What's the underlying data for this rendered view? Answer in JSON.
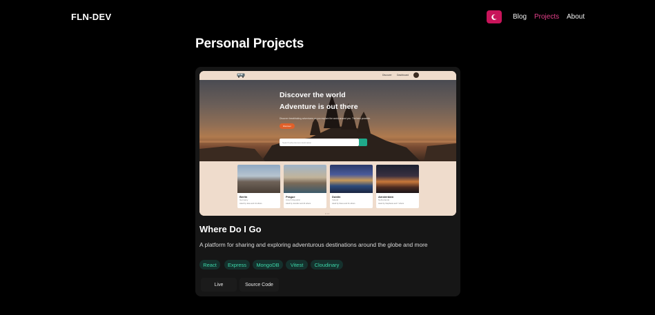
{
  "header": {
    "brand": "FLN-DEV",
    "theme_icon": "moon-icon",
    "accent": "#c8145a",
    "nav": [
      {
        "label": "Blog",
        "active": false
      },
      {
        "label": "Projects",
        "active": true
      },
      {
        "label": "About",
        "active": false
      }
    ]
  },
  "page": {
    "title": "Personal Projects"
  },
  "project": {
    "preview": {
      "nav_links": [
        "Discover",
        "Dashboard"
      ],
      "hero_line1": "Discover the world",
      "hero_line2": "Adventure is out there",
      "hero_sub": "Discover breathtaking adventures as you explore the world around you. The best possible.",
      "hero_button": "Discover",
      "search_placeholder": "Search adventurous destination",
      "cities": [
        {
          "name": "Berlin",
          "country": "Germany",
          "meta": "Liked by Jane and 13 others"
        },
        {
          "name": "Prague",
          "country": "Czech Republic",
          "meta": "Liked by Jennifer and 24 others"
        },
        {
          "name": "Dublin",
          "country": "Ireland",
          "meta": "Liked by Steve and 31 others"
        },
        {
          "name": "Amsterdam",
          "country": "Netherlands",
          "meta": "Liked by Stephanie and 7 others"
        }
      ]
    },
    "title": "Where Do I Go",
    "description": "A platform for sharing and exploring adventurous destinations around the globe and more",
    "tags": [
      "React",
      "Express",
      "MongoDB",
      "Vitest",
      "Cloudinary"
    ],
    "tag_color": "#3bd6a8",
    "buttons": {
      "live": "Live",
      "source": "Source Code"
    }
  }
}
